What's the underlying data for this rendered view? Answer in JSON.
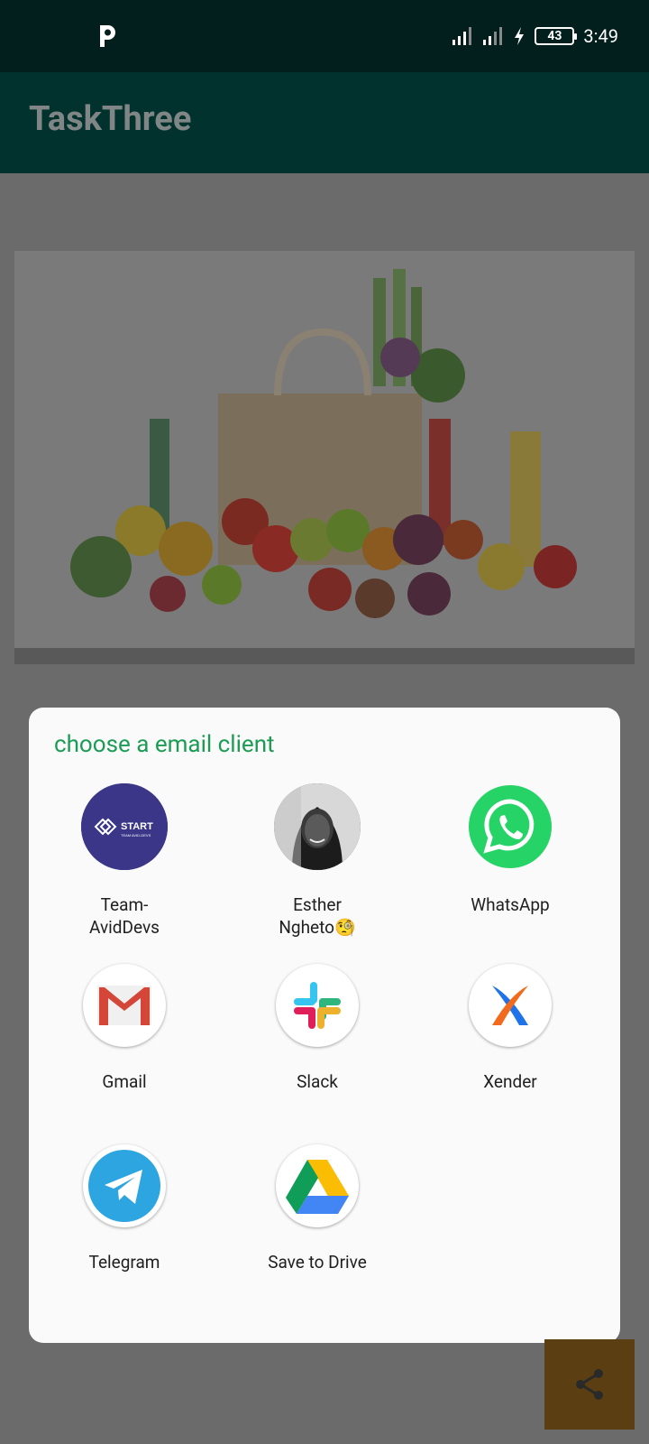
{
  "status_bar": {
    "time": "3:49",
    "battery": "43"
  },
  "app_bar": {
    "title": "TaskThree"
  },
  "dialog": {
    "title": "choose a email client",
    "apps": [
      {
        "label": "Team-\nAvidDevs"
      },
      {
        "label": "Esther\nNgheto🧐"
      },
      {
        "label": "WhatsApp"
      },
      {
        "label": "Gmail"
      },
      {
        "label": "Slack"
      },
      {
        "label": "Xender"
      },
      {
        "label": "Telegram"
      },
      {
        "label": "Save to Drive"
      }
    ]
  },
  "hero": {
    "avatar_text_primary": "START",
    "avatar_text_secondary": "TEAM AVID-DEVS"
  },
  "colors": {
    "dialog_title": "#1c9b55",
    "status_bar": "#021f1d",
    "app_bar": "#01322d",
    "scrim": "#6b6b6b",
    "fab": "#5b3f12"
  }
}
